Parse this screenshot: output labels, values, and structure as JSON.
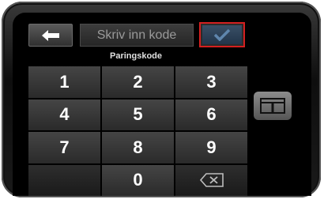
{
  "header": {
    "back_icon": "arrow-left-icon",
    "code_placeholder": "Skriv inn kode",
    "confirm_icon": "checkmark-icon",
    "field_label": "Paringskode"
  },
  "keypad": {
    "keys": [
      "1",
      "2",
      "3",
      "4",
      "5",
      "6",
      "7",
      "8",
      "9",
      "",
      "0",
      ""
    ],
    "backspace_icon": "backspace-icon"
  },
  "side": {
    "toggle_icon": "keyboard-toggle-icon"
  },
  "colors": {
    "highlight": "#d42020",
    "confirm_fill": "#2d4257",
    "key_face": "#3a3a3a"
  }
}
